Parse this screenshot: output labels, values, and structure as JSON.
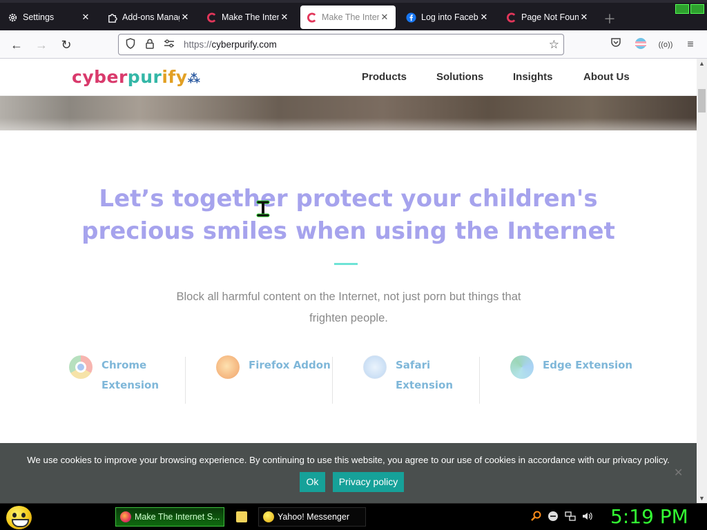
{
  "browser": {
    "tabs": [
      {
        "title": "Settings",
        "icon": "gear-icon",
        "active": false
      },
      {
        "title": "Add-ons Manag",
        "icon": "puzzle-icon",
        "active": false
      },
      {
        "title": "Make The Intern",
        "icon": "cyberpurify-icon",
        "active": false
      },
      {
        "title": "Make The Intern",
        "icon": "cyberpurify-icon",
        "active": true
      },
      {
        "title": "Log into Facebo",
        "icon": "facebook-icon",
        "active": false
      },
      {
        "title": "Page Not Found",
        "icon": "cyberpurify-icon",
        "active": false
      }
    ],
    "url_scheme": "https://",
    "url_host": "cyberpurify.com"
  },
  "site": {
    "logo": {
      "part1": "cyber",
      "part2": "pur",
      "part3": "ify",
      "part4": "⁂"
    },
    "menu": [
      "Products",
      "Solutions",
      "Insights",
      "About Us"
    ],
    "headline_line1": "Let’s together protect your children's",
    "headline_line2": "precious smiles when using the Internet",
    "subtext": "Block all harmful content on the Internet, not just porn but things that frighten people.",
    "extensions": [
      {
        "line1": "Chrome",
        "line2": "Extension",
        "icon": "chrome-icon"
      },
      {
        "line1": "Firefox Addon",
        "line2": "",
        "icon": "firefox-icon"
      },
      {
        "line1": "Safari",
        "line2": "Extension",
        "icon": "safari-icon"
      },
      {
        "line1": "Edge Extension",
        "line2": "",
        "icon": "edge-icon"
      }
    ]
  },
  "cookie": {
    "message": "We use cookies to improve your browsing experience. By continuing to use this website, you agree to our use of cookies in accordance with our privacy policy.",
    "ok_label": "Ok",
    "policy_label": "Privacy policy",
    "close_glyph": "✕"
  },
  "taskbar": {
    "tasks": [
      {
        "label": "Make The Internet S...",
        "icon": "firefox-icon"
      },
      {
        "label": "Yahoo! Messenger",
        "icon": "messenger-icon"
      }
    ],
    "clock": "5:19 PM"
  },
  "colors": {
    "headline": "#a6a3ed",
    "accent_teal": "#16a199",
    "link_blue": "#7fb7d9",
    "clock_green": "#33ff33"
  }
}
